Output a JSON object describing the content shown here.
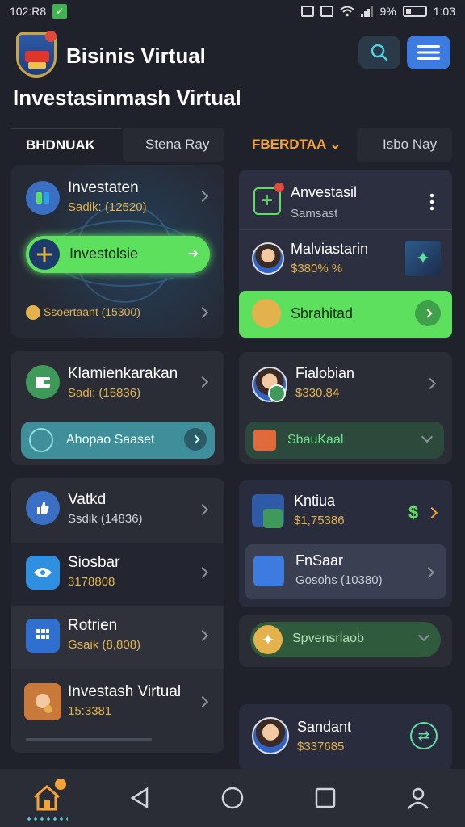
{
  "status_bar": {
    "time_left": "102:R8",
    "battery_pct": "9%",
    "time_right": "1:03"
  },
  "header": {
    "app_name": "Bisinis Virtual",
    "page_title": "Investasinmash Virtual"
  },
  "tabs": [
    {
      "label": "BHDNUAK"
    },
    {
      "label": "Stena Ray"
    },
    {
      "label": "FBERDTAA",
      "arrow": "⌄"
    },
    {
      "label": "Isbo Nay"
    }
  ],
  "left_col": {
    "card1": {
      "title": "Investaten",
      "subtitle": "Sadik: (12520)",
      "button_label": "Investolsie",
      "footer_text": "Ssoertaant (15300)"
    },
    "card2": {
      "title": "Klamienkarakan",
      "subtitle": "Sadi: (15836)",
      "pill_label": "Ahopao Saaset"
    },
    "card3": {
      "items": [
        {
          "title": "Vatkd",
          "subtitle": "Ssdik (14836)"
        },
        {
          "title": "Siosbar",
          "subtitle": "3178808"
        },
        {
          "title": "Rotrien",
          "subtitle": "Gsaik (8,808)"
        },
        {
          "title": "Investash Virtual",
          "subtitle": "15:3381"
        }
      ]
    }
  },
  "right_col": {
    "card1": {
      "title": "Anvestasil",
      "subtitle": "Samsast",
      "item_title": "Malviastarin",
      "item_value": "$380% %",
      "button_label": "Sbrahitad"
    },
    "card2": {
      "title": "Fialobian",
      "value": "$330.84",
      "pill_label": "SbauKaal"
    },
    "card3": {
      "title": "Kntiua",
      "value": "$1,75386",
      "currency_symbol": "$",
      "inner_title": "FnSaar",
      "inner_subtitle": "Gosohs (10380)"
    },
    "pill_green": {
      "label": "Spvensrlaob"
    },
    "card4": {
      "title": "Sandant",
      "value": "$337685"
    }
  },
  "colors": {
    "bg": "#1f222b",
    "card": "#2a2d36",
    "green": "#5ee05f",
    "gold": "#e3b24c",
    "accent_blue": "#3d7be0",
    "orange": "#f4a23a"
  }
}
